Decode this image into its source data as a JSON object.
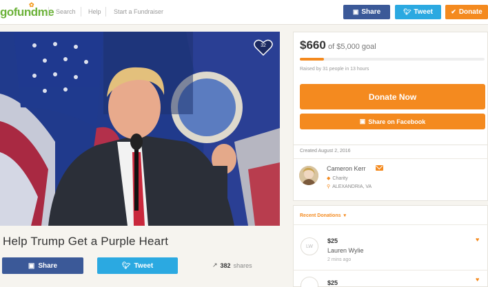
{
  "header": {
    "logo": "gofundme",
    "nav": [
      "Search",
      "Help",
      "Start a Fundraiser"
    ],
    "share_label": "Share",
    "tweet_label": "Tweet",
    "donate_label": "Donate"
  },
  "hero": {
    "heart_count": "32"
  },
  "campaign": {
    "title": "Help Trump Get a Purple Heart",
    "share_label": "Share",
    "tweet_label": "Tweet",
    "share_count": "382",
    "shares_label": "shares"
  },
  "goal": {
    "raised": "$660",
    "goal_text": "of $5,000 goal",
    "progress_fraction": 0.132,
    "raised_by": "Raised by 31 people in 13 hours",
    "donate_now_label": "Donate Now",
    "share_facebook_label": "Share on Facebook"
  },
  "organizer": {
    "created": "Created August 2, 2016",
    "name": "Cameron Kerr",
    "category": "Charity",
    "location": "ALEXANDRIA, VA"
  },
  "recent": {
    "title": "Recent Donations",
    "donations": [
      {
        "initials": "LW",
        "amount": "$25",
        "name": "Lauren Wylie",
        "time": "2 mins ago"
      },
      {
        "initials": "",
        "amount": "$25",
        "name": "",
        "time": ""
      }
    ]
  },
  "colors": {
    "brand_green": "#6cb23a",
    "accent_orange": "#f48a1f",
    "facebook_blue": "#3b5998",
    "twitter_blue": "#2ba9e1"
  }
}
